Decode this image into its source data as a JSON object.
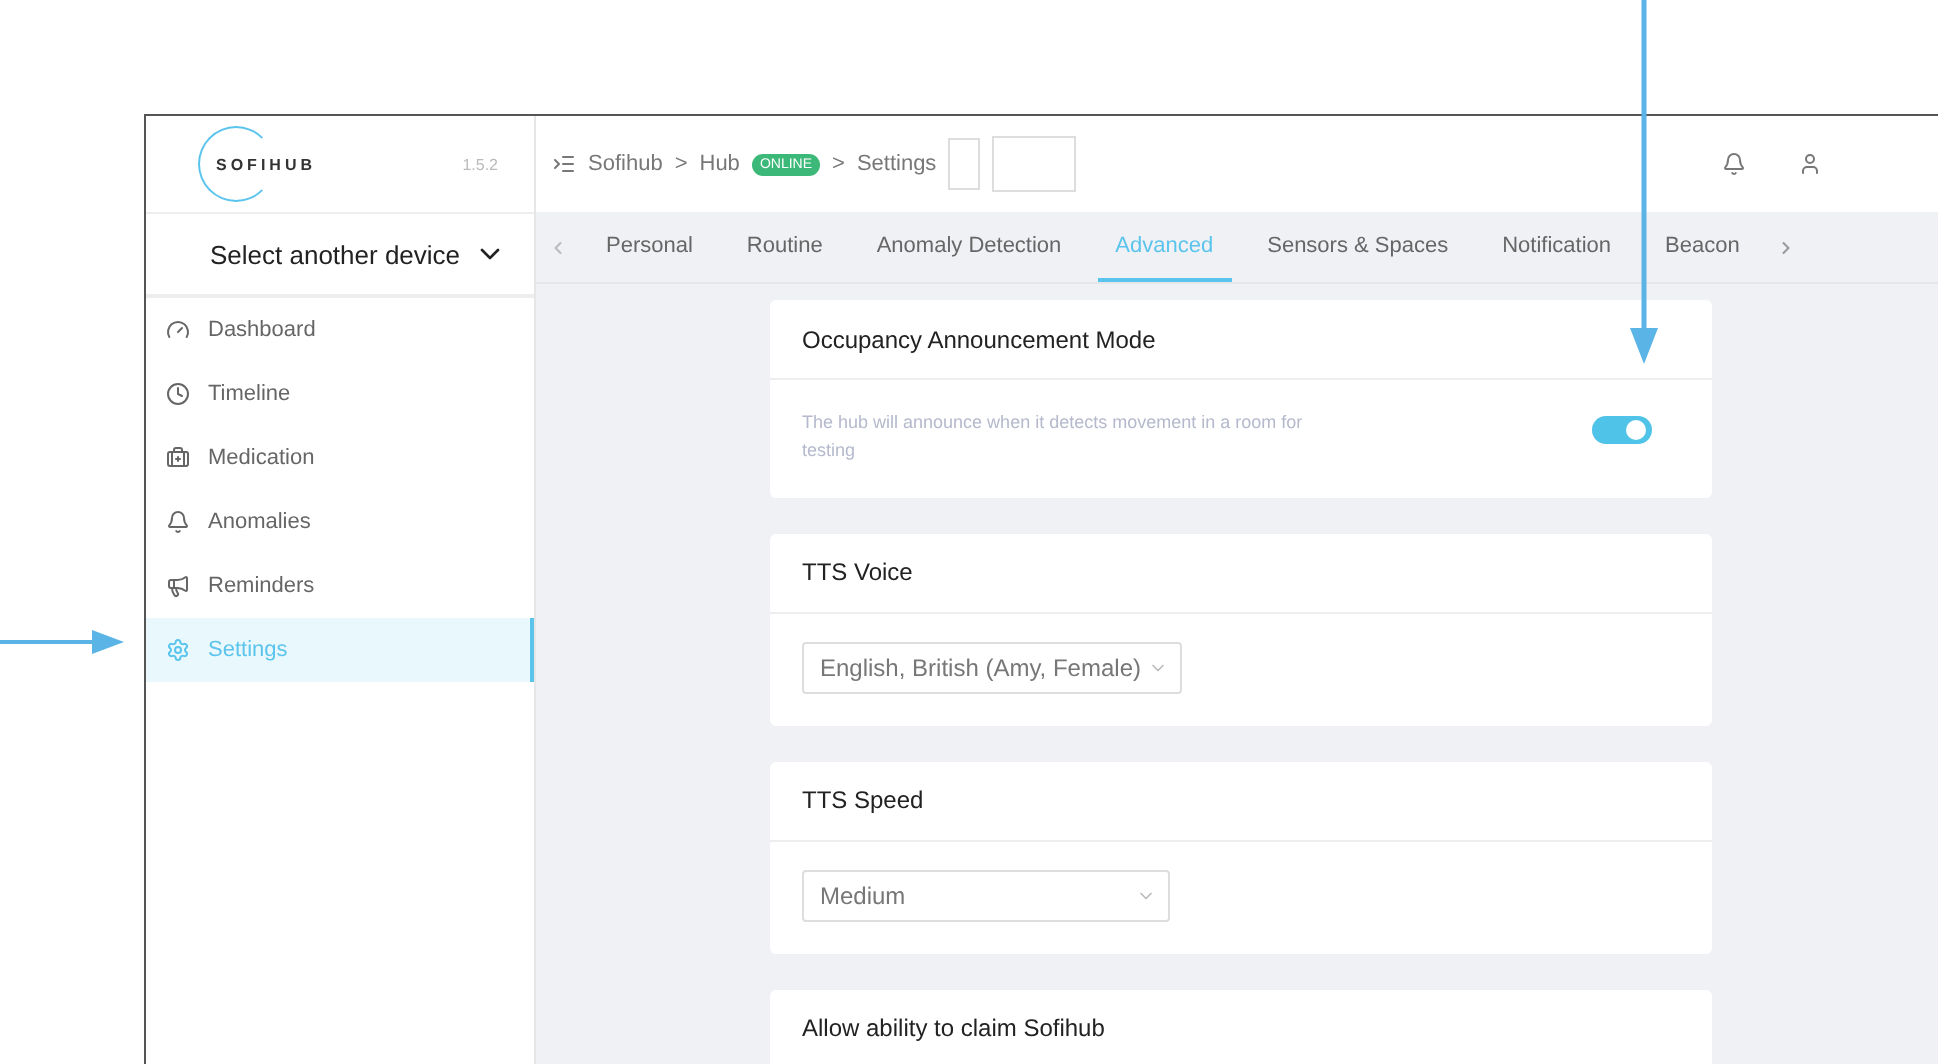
{
  "logo": {
    "text": "SOFIHUB",
    "version": "1.5.2"
  },
  "breadcrumb": [
    {
      "kind": "link",
      "text": "Sofihub"
    },
    {
      "kind": "separator",
      "text": ">"
    },
    {
      "kind": "link",
      "text": "Hub"
    },
    {
      "kind": "badge",
      "text": "ONLINE"
    },
    {
      "kind": "separator",
      "text": ">"
    },
    {
      "kind": "current",
      "text": "Settings"
    }
  ],
  "device_select": {
    "label": "Select another device"
  },
  "sidebar": {
    "items": [
      {
        "label": "Dashboard",
        "selected": false
      },
      {
        "label": "Timeline",
        "selected": false
      },
      {
        "label": "Medication",
        "selected": false
      },
      {
        "label": "Anomalies",
        "selected": false
      },
      {
        "label": "Reminders",
        "selected": false
      },
      {
        "label": "Settings",
        "selected": true
      }
    ]
  },
  "tabs": [
    {
      "label": "Personal",
      "selected": false
    },
    {
      "label": "Routine",
      "selected": false
    },
    {
      "label": "Anomaly Detection",
      "selected": false
    },
    {
      "label": "Advanced",
      "selected": true
    },
    {
      "label": "Sensors & Spaces",
      "selected": false
    },
    {
      "label": "Notification",
      "selected": false
    },
    {
      "label": "Beacon",
      "selected": false
    }
  ],
  "cards": [
    {
      "kind": "toggle",
      "title": "Occupancy Announcement Mode",
      "description": "The hub will announce when it detects movement in a room for testing",
      "on": true
    },
    {
      "kind": "select",
      "title": "TTS Voice",
      "value": "English, British (Amy, Female)"
    },
    {
      "kind": "select",
      "title": "TTS Speed",
      "value": "Medium"
    },
    {
      "kind": "header",
      "title": "Allow ability to claim Sofihub"
    }
  ]
}
